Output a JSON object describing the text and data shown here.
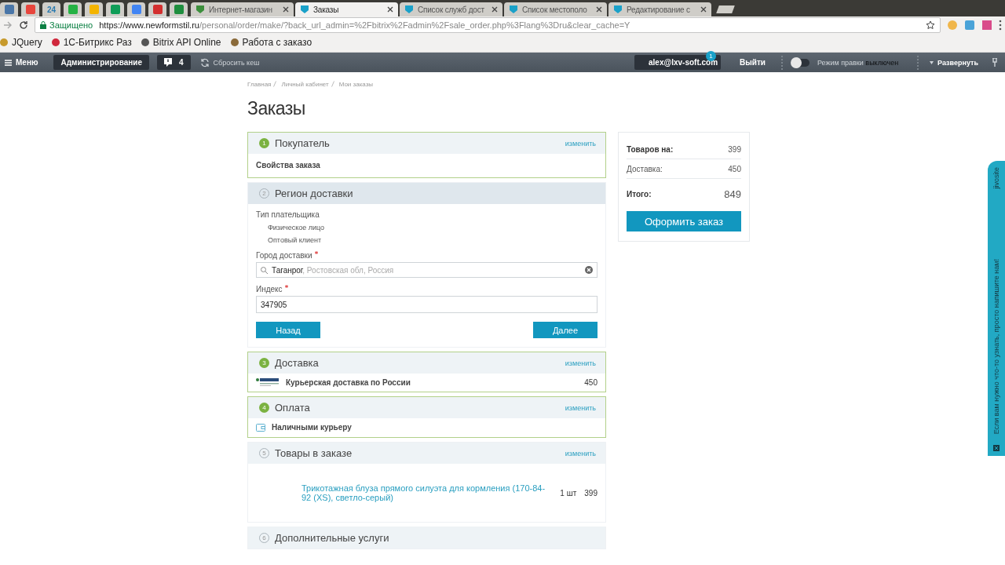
{
  "browser": {
    "pinned_tabs": [
      {
        "kind": "icon",
        "color": "#4a76a8"
      },
      {
        "kind": "icon",
        "color": "#e8453c"
      },
      {
        "kind": "text",
        "label": "24",
        "color": "#2a7ab0"
      },
      {
        "kind": "icon",
        "color": "#25b244"
      },
      {
        "kind": "icon",
        "color": "#f4b400"
      },
      {
        "kind": "icon",
        "color": "#0f9d58"
      },
      {
        "kind": "icon",
        "color": "#4285f4"
      },
      {
        "kind": "icon",
        "color": "#d32f2f"
      },
      {
        "kind": "icon",
        "color": "#1e8e3e"
      }
    ],
    "tabs": [
      {
        "title": "Интернет-магазин",
        "selected": false,
        "color": "#3c8f3c"
      },
      {
        "title": "Заказы",
        "selected": true,
        "color": "#1aa1c9"
      },
      {
        "title": "Список служб дост",
        "selected": false,
        "color": "#1aa1c9"
      },
      {
        "title": "Список местополо",
        "selected": false,
        "color": "#1aa1c9"
      },
      {
        "title": "Редактирование с",
        "selected": false,
        "color": "#1aa1c9"
      }
    ],
    "address": {
      "secure_label": "Защищено",
      "host": "https://www.newformstil.ru",
      "path": "/personal/order/make/?back_url_admin=%2Fbitrix%2Fadmin%2Fsale_order.php%3Flang%3Dru&clear_cache=Y"
    },
    "bookmarks": [
      {
        "label": "JQuery",
        "color": "#c79a2c"
      },
      {
        "label": "1С-Битрикс Раз",
        "color": "#d0283c"
      },
      {
        "label": "Bitrix API Online",
        "color": "#555555"
      },
      {
        "label": "Работа с заказо",
        "color": "#8a6a3a"
      }
    ]
  },
  "admin_bar": {
    "menu": "Меню",
    "admin": "Администрирование",
    "notifications": "4",
    "reset_cache": "Сбросить кеш",
    "cart_badge": "1",
    "user": "alex@lxv-soft.com",
    "logout": "Выйти",
    "edit_mode": {
      "label": "Режим правки",
      "state": "выключен",
      "on": false
    },
    "expand": "Развернуть"
  },
  "breadcrumbs": [
    "Главная",
    "Личный кабинет",
    "Мои заказы"
  ],
  "title": "Заказы",
  "steps": [
    {
      "number": "1",
      "title": "Покупатель",
      "completed": true,
      "current": false,
      "change": "изменить",
      "kind": "text",
      "text": "Свойства заказа"
    },
    {
      "number": "2",
      "title": "Регион доставки",
      "completed": false,
      "current": true,
      "kind": "region",
      "payer_label": "Тип плательщика",
      "payer_options": [
        "Физическое лицо",
        "Оптовый клиент"
      ],
      "city": {
        "label": "Город доставки",
        "required": true,
        "value": "Таганрог",
        "hint": ", Ростовская обл, Россия"
      },
      "index": {
        "label": "Индекс",
        "required": true,
        "value": "347905"
      },
      "back": "Назад",
      "next": "Далее"
    },
    {
      "number": "3",
      "title": "Доставка",
      "completed": true,
      "current": false,
      "change": "изменить",
      "kind": "delivery",
      "name": "Курьерская доставка по России",
      "price": "450"
    },
    {
      "number": "4",
      "title": "Оплата",
      "completed": true,
      "current": false,
      "change": "изменить",
      "kind": "payment",
      "name": "Наличными курьеру"
    },
    {
      "number": "5",
      "title": "Товары в заказе",
      "completed": false,
      "current": false,
      "change": "изменить",
      "kind": "products",
      "items": [
        {
          "name": "Трикотажная блуза прямого силуэта для кормления (170-84-92 (XS), светло-серый)",
          "qty": "1 шт",
          "price": "399"
        }
      ]
    },
    {
      "number": "6",
      "title": "Дополнительные услуги",
      "completed": false,
      "current": false,
      "kind": "empty"
    }
  ],
  "summary": {
    "rows": [
      {
        "label": "Товаров на:",
        "value": "399",
        "kind": "bold"
      },
      {
        "label": "Доставка:",
        "value": "450",
        "kind": "plain"
      }
    ],
    "total": {
      "label": "Итого:",
      "value": "849"
    },
    "button": "Оформить заказ"
  },
  "chat": {
    "brand": "jivosite",
    "text": "Если вам нужно что-то узнать, просто напишите нам!"
  }
}
